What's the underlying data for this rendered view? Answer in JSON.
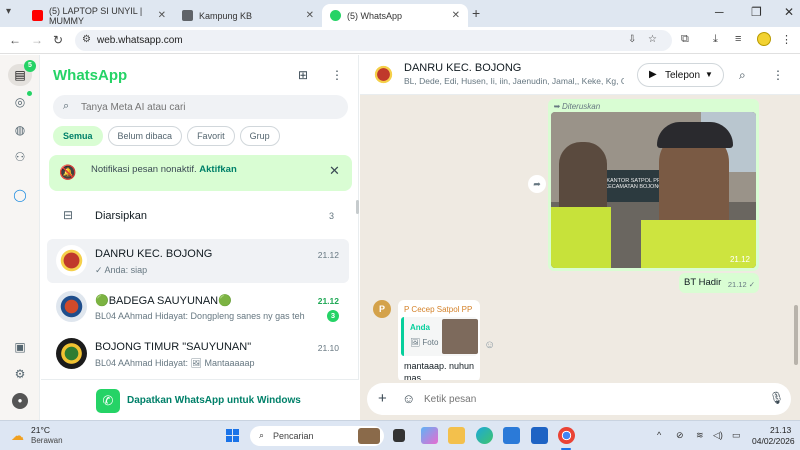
{
  "browser": {
    "tabs": [
      {
        "label": "(5) LAPTOP SI UNYIL | MUMMY",
        "close": "✕",
        "favicon_color": "#ff0000"
      },
      {
        "label": "Kampung KB",
        "close": "✕",
        "favicon_color": "#5f6368"
      },
      {
        "label": "(5) WhatsApp",
        "close": "✕",
        "favicon_color": "#25d366"
      }
    ],
    "new_tab": "+",
    "url": "web.whatsapp.com"
  },
  "rail": {
    "chats_badge": "5"
  },
  "sidebar": {
    "brand": "WhatsApp",
    "search_placeholder": "Tanya Meta AI atau cari",
    "filters": [
      "Semua",
      "Belum dibaca",
      "Favorit",
      "Grup"
    ],
    "notification": {
      "text": "Notifikasi pesan nonaktif.",
      "action": "Aktifkan"
    },
    "archived": {
      "label": "Diarsipkan",
      "count": "3"
    },
    "chats": [
      {
        "name": "DANRU KEC. BOJONG",
        "time": "21.12",
        "preview": "✓ Anda: siap",
        "unread": ""
      },
      {
        "name": "🟢BADEGA SAUYUNAN🟢",
        "time": "21.12",
        "preview": "BL04 AAhmad Hidayat: Dongpleng sanes ny gas teh",
        "unread": "3"
      },
      {
        "name": "BOJONG TIMUR \"SAUYUNAN\"",
        "time": "21.10",
        "preview": "BL04 AAhmad Hidayat: 🖼 Mantaaaaap",
        "unread": ""
      }
    ],
    "promo": "Dapatkan WhatsApp untuk Windows"
  },
  "conversation": {
    "title": "DANRU KEC. BOJONG",
    "members": "BL, Dede, Edi, Husen, Ii, iin, Jaenudin, Jamal,, Keke, Kg, Om...",
    "call_label": "Telepon",
    "forwarded_label": "Diteruskan",
    "photo_sign": "KANTOR SATPOL PP KECAMATAN BOJONG",
    "photo_time": "21.12",
    "outgoing": {
      "text": "BT Hadir",
      "time": "21.12 ✓"
    },
    "incoming": {
      "avatar_letter": "P",
      "sender": "P Cecep Satpol PP",
      "quote_author": "Anda",
      "quote_type": "🖼 Foto",
      "body": "mantaaap. nuhun mas"
    },
    "composer_placeholder": "Ketik pesan"
  },
  "taskbar": {
    "temperature": "21°C",
    "weather": "Berawan",
    "search_label": "Pencarian",
    "time": "21.13",
    "date": "04/02/2026"
  }
}
